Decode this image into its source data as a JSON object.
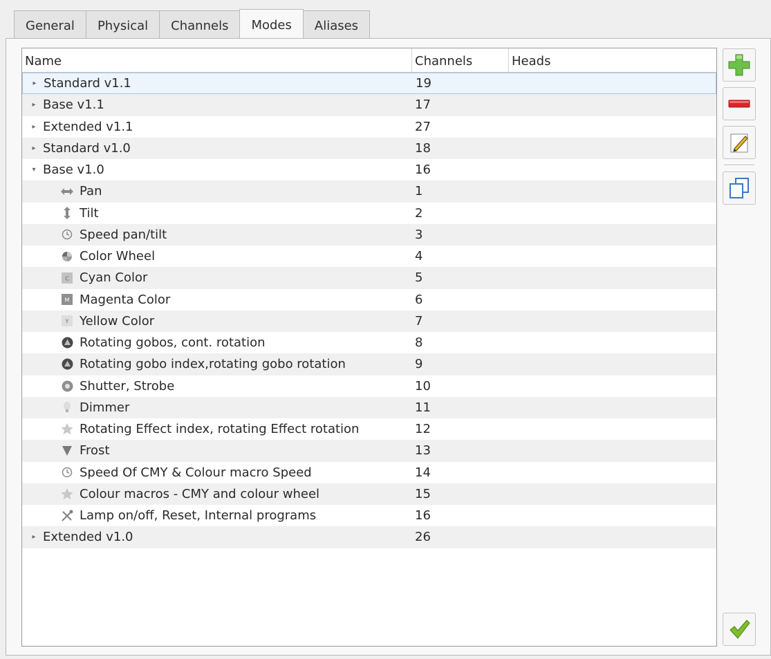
{
  "tabs": [
    {
      "label": "General",
      "active": false
    },
    {
      "label": "Physical",
      "active": false
    },
    {
      "label": "Channels",
      "active": false
    },
    {
      "label": "Modes",
      "active": true
    },
    {
      "label": "Aliases",
      "active": false
    }
  ],
  "columns": {
    "name": "Name",
    "channels": "Channels",
    "heads": "Heads"
  },
  "rows": [
    {
      "kind": "mode",
      "expanded": false,
      "selected": true,
      "name": "Standard v1.1",
      "channels": "19"
    },
    {
      "kind": "mode",
      "expanded": false,
      "name": "Base v1.1",
      "channels": "17"
    },
    {
      "kind": "mode",
      "expanded": false,
      "name": "Extended v1.1",
      "channels": "27"
    },
    {
      "kind": "mode",
      "expanded": false,
      "name": "Standard v1.0",
      "channels": "18"
    },
    {
      "kind": "mode",
      "expanded": true,
      "name": "Base v1.0",
      "channels": "16"
    },
    {
      "kind": "channel",
      "icon": "pan-icon",
      "name": "Pan",
      "channels": "1"
    },
    {
      "kind": "channel",
      "icon": "tilt-icon",
      "name": "Tilt",
      "channels": "2"
    },
    {
      "kind": "channel",
      "icon": "speed-icon",
      "name": "Speed pan/tilt",
      "channels": "3"
    },
    {
      "kind": "channel",
      "icon": "color-wheel-icon",
      "name": "Color Wheel",
      "channels": "4"
    },
    {
      "kind": "channel",
      "icon": "cyan-icon",
      "glyph": "C",
      "name": "Cyan Color",
      "channels": "5"
    },
    {
      "kind": "channel",
      "icon": "magenta-icon",
      "glyph": "M",
      "name": "Magenta Color",
      "channels": "6"
    },
    {
      "kind": "channel",
      "icon": "yellow-icon",
      "glyph": "Y",
      "name": "Yellow Color",
      "channels": "7"
    },
    {
      "kind": "channel",
      "icon": "gobo-icon",
      "name": "Rotating gobos, cont. rotation",
      "channels": "8"
    },
    {
      "kind": "channel",
      "icon": "gobo-icon",
      "name": "Rotating gobo index,rotating gobo rotation",
      "channels": "9"
    },
    {
      "kind": "channel",
      "icon": "shutter-icon",
      "name": "Shutter, Strobe",
      "channels": "10"
    },
    {
      "kind": "channel",
      "icon": "dimmer-icon",
      "name": "Dimmer",
      "channels": "11"
    },
    {
      "kind": "channel",
      "icon": "effect-icon",
      "name": "Rotating Effect index, rotating Effect rotation",
      "channels": "12"
    },
    {
      "kind": "channel",
      "icon": "frost-icon",
      "name": "Frost",
      "channels": "13"
    },
    {
      "kind": "channel",
      "icon": "speed-icon",
      "name": "Speed Of CMY & Colour macro Speed",
      "channels": "14"
    },
    {
      "kind": "channel",
      "icon": "effect-icon",
      "name": "Colour macros - CMY and colour wheel",
      "channels": "15"
    },
    {
      "kind": "channel",
      "icon": "maintenance-icon",
      "name": "Lamp on/off, Reset, Internal programs",
      "channels": "16"
    },
    {
      "kind": "mode",
      "expanded": false,
      "name": "Extended v1.0",
      "channels": "26"
    }
  ],
  "toolbar": [
    {
      "name": "add-mode-button",
      "icon": "plus-icon",
      "color": "#6cc14a"
    },
    {
      "name": "remove-mode-button",
      "icon": "minus-icon",
      "color": "#d9262b"
    },
    {
      "name": "edit-mode-button",
      "icon": "pencil-icon",
      "color": "#e8b830"
    },
    {
      "name": "clone-mode-button",
      "icon": "copy-icon",
      "color": "#3a78c4"
    },
    {
      "name": "ok-button",
      "icon": "checkmark-icon",
      "color": "#6aab1e"
    }
  ]
}
